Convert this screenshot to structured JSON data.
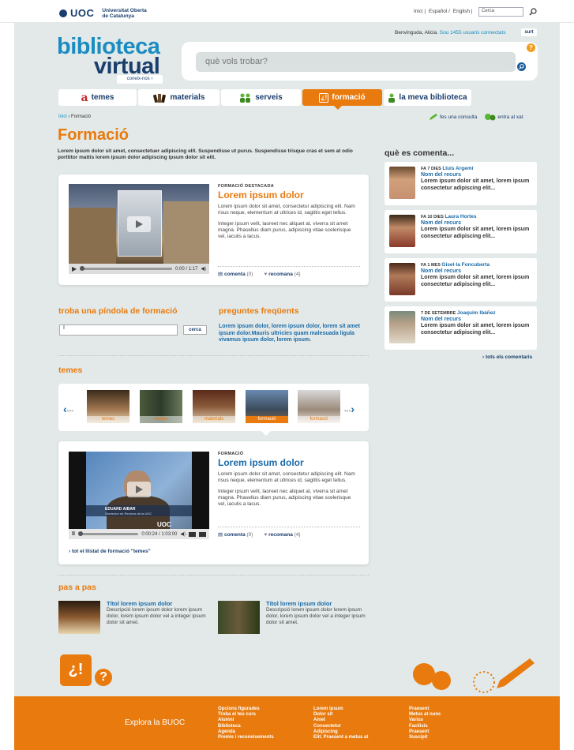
{
  "topbar": {
    "logo_word": "UOC",
    "logo_sub1": "Universitat Oberta",
    "logo_sub2": "de Catalunya",
    "links": [
      "Inici |",
      "Español /",
      "English |"
    ],
    "search_placeholder": "Cerca"
  },
  "user": {
    "welcome": "Benvinguda, Alicia.",
    "online": "Sou 1455 usuaris connectats",
    "logout": "surt"
  },
  "brand": {
    "line1": "biblioteca",
    "line2": "virtual",
    "about": "coneix-nos ›"
  },
  "search": {
    "placeholder": "què vols trobar?",
    "help": "?"
  },
  "nav": {
    "tabs": [
      {
        "label": "temes",
        "icon": "a"
      },
      {
        "label": "materials",
        "icon": "books"
      },
      {
        "label": "serveis",
        "icon": "people"
      },
      {
        "label": "formació",
        "icon": "question"
      },
      {
        "label": "la meva biblioteca",
        "icon": "person"
      }
    ],
    "active_index": 3
  },
  "breadcrumb": {
    "home": "Inici",
    "current": "› Formació"
  },
  "actions": {
    "consult": "fes una consulta",
    "chat": "entra al xat"
  },
  "page": {
    "title": "Formació",
    "intro": "Lorem ipsum dolor sit amet, consectetuer adipiscing elit. Suspendisse ut purus. Suspendisse trisque cras et sem at odio porttitor mattis lorem ipsum dolor adipiscing ipsum dolor sit elit."
  },
  "featured": {
    "kicker": "FORMACIÓ DESTACADA",
    "title": "Lorem ipsum dolor",
    "p1": "Lorem ipsum dolor sit amet, consectetur adipiscing elit. Nam risus neque, elementum at ultrices id, sagittis eget tellus.",
    "p2": "Integer ipsum velit, laoreet nec aliquet at, viverra sit amet magna. Phasellus diam purus, adipiscing vitae scelerisque vel, iaculis a lacus.",
    "time": "0:00 / 1:17",
    "comments_label": "comenta",
    "comments_count": "(0)",
    "recommend_label": "recomana",
    "recommend_count": "(4)"
  },
  "pindola": {
    "title": "troba una píndola de formació",
    "input_value": "I",
    "button": "cerca"
  },
  "faq": {
    "title": "preguntes freqüents",
    "text": "Lorem ipsum dolor, lorem ipsum dolor, lorem sit amet ipsum dolor.Mauris ultricies quam malesuada ligula vivamus ipsum dolor, lorem ipsum."
  },
  "temes": {
    "title": "temes",
    "thumbs": [
      "temes",
      "temes",
      "materials",
      "formació",
      "formació"
    ],
    "active_index": 3
  },
  "second": {
    "kicker": "FORMACIÓ",
    "title": "Lorem ipsum dolor",
    "p1": "Lorem ipsum dolor sit amet, consectetur adipiscing elit. Nam risus neque, elementum at ultrices id, sagittis eget tellus.",
    "p2": "Integer ipsum velit, laoreet nec aliquet at, viverra sit amet magna. Phasellus diam purus, adipiscing vitae scelerisque vel, iaculis a lacus.",
    "time": "0:00:24 / 1:03:00",
    "caption_name": "EDUARD AIBAR",
    "caption_sub": "Vicerector de Recerca de la UOC",
    "screen_logo": "UOC",
    "comments_label": "comenta",
    "comments_count": "(0)",
    "recommend_label": "recomana",
    "recommend_count": "(4)",
    "list_link": "› tot el llistat de formació \"temes\""
  },
  "steps": {
    "title": "pas a pas",
    "items": [
      {
        "title": "Títol lorem ipsum dolor",
        "desc": "Descripció lorem ipsum dolor lorem ipsum dolor, lorem ipsum dolor vel a integer ipsum dolor sit amet."
      },
      {
        "title": "Títol lorem ipsum dolor",
        "desc": "Descripció lorem ipsum dolor lorem ipsum dolor, lorem ipsum dolor vel a integer ipsum dolor sit amet."
      }
    ]
  },
  "sidebar": {
    "title": "què es comenta...",
    "comments": [
      {
        "when": "FA 7 DIES",
        "who": "Lluís Argemí",
        "resource": "Nom del recurs",
        "text": "Lorem ipsum dolor sit amet, lorem ipsum consectetur adipiscing elit..."
      },
      {
        "when": "FA 10 DIES",
        "who": "Laura Hortes",
        "resource": "Nom del recurs",
        "text": "Lorem ipsum dolor sit amet, lorem ipsum consectetur adipiscing elit..."
      },
      {
        "when": "FA 1 MES",
        "who": "Gisel·la Foncuberta",
        "resource": "Nom del recurs",
        "text": "Lorem ipsum dolor sit amet, lorem ipsum consectetur adipiscing elit..."
      },
      {
        "when": "7 DE SETEMBRE",
        "who": "Joaquim Ibáñez",
        "resource": "Nom del recurs",
        "text": "Lorem ipsum dolor sit amet, lorem ipsum consectetur adipiscing elit..."
      }
    ],
    "all_link": "› tots els comentaris"
  },
  "deco": {
    "q1": "¿!",
    "q2": "?"
  },
  "footer": {
    "label": "Explora la BUOC",
    "col1": [
      "Opcions figurades",
      "Troba el teu curs",
      "Alumni",
      "Biblioteca",
      "Agenda",
      "Premis i reconeixements"
    ],
    "col2": [
      "Lorem ipsum",
      "Dolor sit",
      "Amet",
      "Consectetur",
      "Adipiscing",
      "Elit. Praesent a metus at"
    ],
    "col3": [
      "Praesent",
      "Metus at nunc",
      "Varius",
      "Facilisis",
      "Praesent",
      "Suscipit"
    ]
  },
  "colors": {
    "orange": "#e87a0e",
    "blue": "#1b8cc2",
    "navy": "#1a3e6d",
    "panel": "#e2e9e8"
  }
}
